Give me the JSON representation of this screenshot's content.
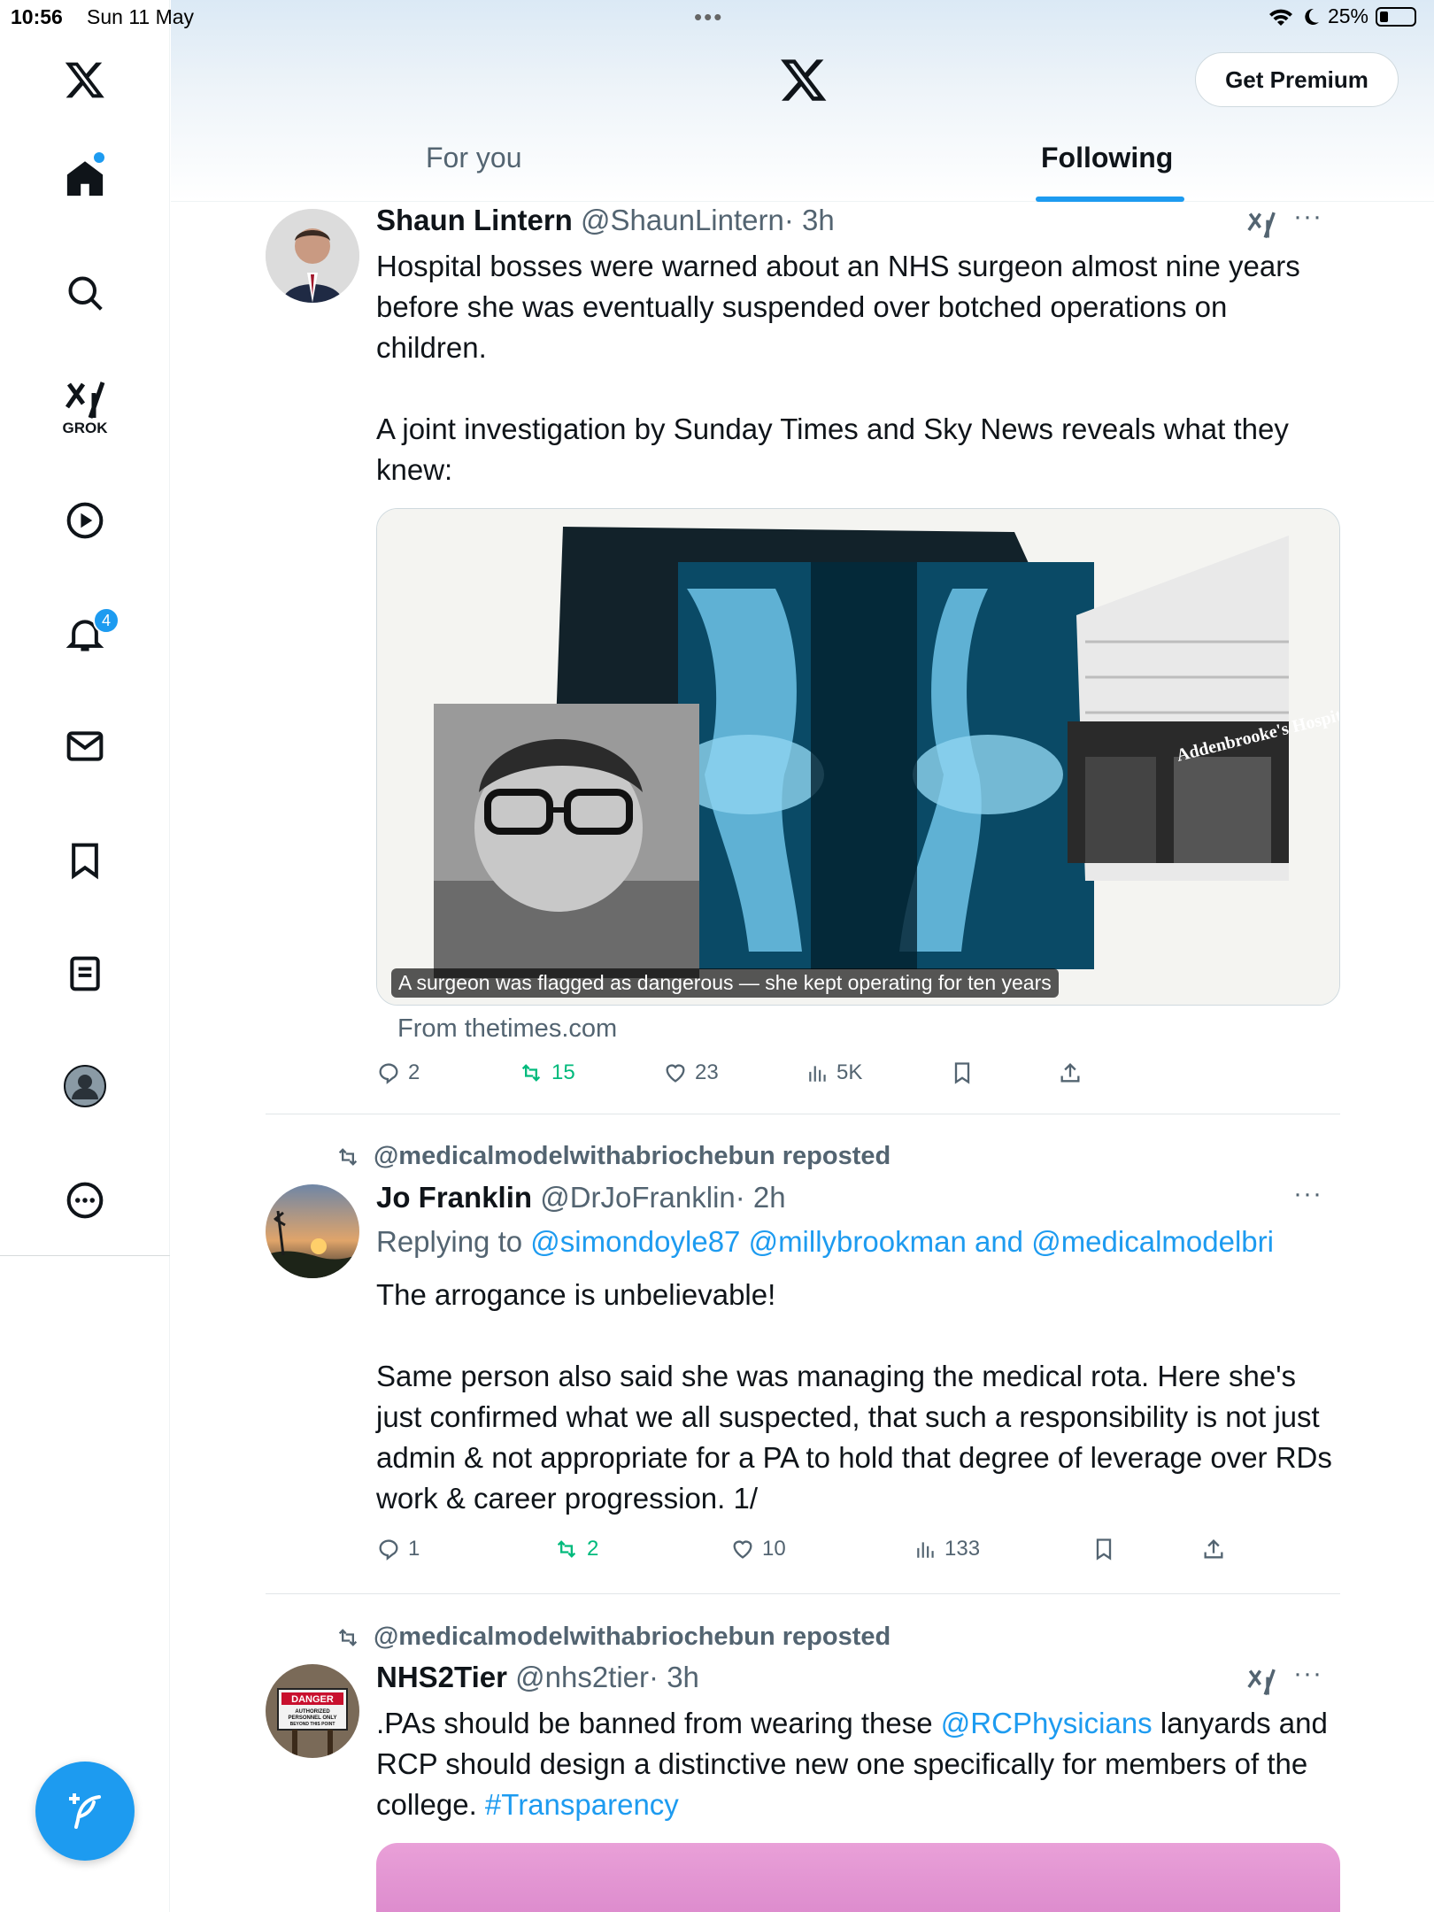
{
  "status_bar": {
    "time": "10:56",
    "date": "Sun 11 May",
    "battery": "25%"
  },
  "sidebar": {
    "logo": "x-logo-icon",
    "items": [
      {
        "name": "home",
        "icon": "home-icon",
        "has_dot": true
      },
      {
        "name": "explore",
        "icon": "search-icon"
      },
      {
        "name": "grok",
        "icon": "grok-icon",
        "label": "GROK"
      },
      {
        "name": "videos",
        "icon": "play-circle-icon"
      },
      {
        "name": "notifications",
        "icon": "bell-icon",
        "badge": "4"
      },
      {
        "name": "messages",
        "icon": "mail-icon"
      },
      {
        "name": "bookmarks",
        "icon": "bookmark-icon"
      },
      {
        "name": "lists",
        "icon": "list-icon"
      },
      {
        "name": "profile",
        "icon": "avatar-icon"
      },
      {
        "name": "more",
        "icon": "more-circle-icon"
      }
    ],
    "compose_icon": "compose-icon"
  },
  "header": {
    "premium_label": "Get Premium",
    "tabs": [
      {
        "label": "For you",
        "active": false
      },
      {
        "label": "Following",
        "active": true
      }
    ]
  },
  "colors": {
    "accent": "#1d9bf0",
    "repost_green": "#00ba7c",
    "secondary_text": "#536471"
  },
  "posts": [
    {
      "name": "Shaun Lintern",
      "handle": "@ShaunLintern",
      "time": "· 3h",
      "paragraphs": [
        "Hospital bosses were warned about an NHS surgeon almost nine years before she was eventually suspended over botched operations on children.",
        "",
        "A joint investigation by Sunday Times and Sky News reveals what they knew:"
      ],
      "card_caption": "A surgeon was flagged as dangerous — she kept operating for ten years",
      "card_sign_text": "Addenbrooke's Hospital",
      "card_source": "From thetimes.com",
      "stats": {
        "replies": "2",
        "reposts": "15",
        "likes": "23",
        "views": "5K"
      }
    },
    {
      "reposted_by": "@medicalmodelwithabriochebun reposted",
      "name": "Jo Franklin",
      "handle": "@DrJoFranklin",
      "time": "· 2h",
      "replying_prefix": "Replying to",
      "replying_to": "@simondoyle87 @millybrookman and @medicalmodelbri",
      "paragraphs": [
        "The arrogance is unbelievable!",
        "",
        "Same person also said she was managing the medical rota. Here she's just confirmed what we all suspected, that such a responsibility is not just admin & not appropriate for a PA to hold that degree of leverage over RDs work & career progression. 1/"
      ],
      "stats": {
        "replies": "1",
        "reposts": "2",
        "likes": "10",
        "views": "133"
      }
    },
    {
      "reposted_by": "@medicalmodelwithabriochebun reposted",
      "name": "NHS2Tier",
      "handle": "@nhs2tier",
      "time": "· 3h",
      "text_before": ".PAs should be banned from wearing these ",
      "mention": "@RCPhysicians",
      "text_middle": " lanyards and RCP should design a distinctive new one specifically for members of the college. ",
      "hashtag": "#Transparency",
      "avatar_sign_lines": [
        "DANGER",
        "AUTHORIZED",
        "PERSONNEL ONLY",
        "BEYOND THIS POINT"
      ]
    }
  ]
}
